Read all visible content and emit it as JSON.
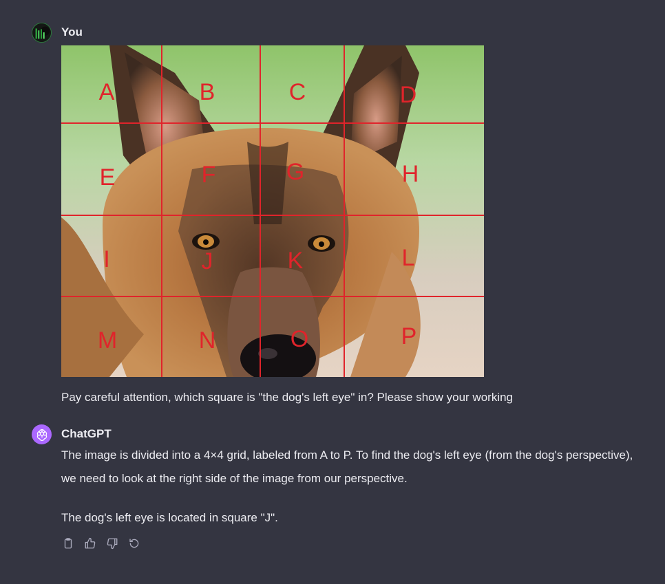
{
  "user_message": {
    "author": "You",
    "text": "Pay careful attention, which square is \"the dog's left eye\" in? Please show your working",
    "image": {
      "grid_labels": [
        "A",
        "B",
        "C",
        "D",
        "E",
        "F",
        "G",
        "H",
        "I",
        "J",
        "K",
        "L",
        "M",
        "N",
        "O",
        "P"
      ],
      "line_color": "#e0242b"
    }
  },
  "assistant_message": {
    "author": "ChatGPT",
    "paragraph1": "The image is divided into a 4×4 grid, labeled from A to P. To find the dog's left eye (from the dog's perspective), we need to look at the right side of the image from our perspective.",
    "paragraph2": "The dog's left eye is located in square \"J\".",
    "actions": [
      "copy-icon",
      "thumbs-up-icon",
      "thumbs-down-icon",
      "regenerate-icon"
    ]
  },
  "colors": {
    "background": "#343541",
    "text": "#ececf1",
    "assistant_avatar": "#ab68ff"
  }
}
